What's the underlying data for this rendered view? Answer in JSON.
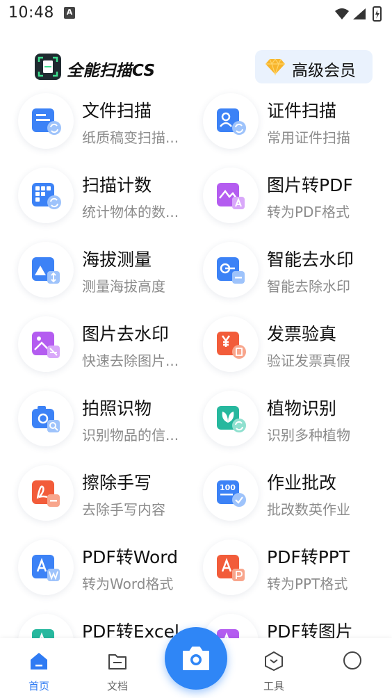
{
  "status_bar": {
    "time": "10:48",
    "notification_letter": "A"
  },
  "header": {
    "app_title": "全能扫描CS",
    "vip_label": "高级会员"
  },
  "colors": {
    "accent": "#2f86f6",
    "tab_active": "#2f7bf3",
    "vip_bg": "#eaf2fd"
  },
  "tools": [
    {
      "title": "文件扫描",
      "subtitle": "纸质稿变扫描...",
      "icon": "document-scan-icon"
    },
    {
      "title": "证件扫描",
      "subtitle": "常用证件扫描",
      "icon": "id-card-scan-icon"
    },
    {
      "title": "扫描计数",
      "subtitle": "统计物体的数...",
      "icon": "scan-count-icon"
    },
    {
      "title": "图片转PDF",
      "subtitle": "转为PDF格式",
      "icon": "image-to-pdf-icon"
    },
    {
      "title": "海拔测量",
      "subtitle": "测量海拔高度",
      "icon": "altitude-icon"
    },
    {
      "title": "智能去水印",
      "subtitle": "智能去除水印",
      "icon": "smart-watermark-remove-icon"
    },
    {
      "title": "图片去水印",
      "subtitle": "快速去除图片...",
      "icon": "image-watermark-remove-icon"
    },
    {
      "title": "发票验真",
      "subtitle": "验证发票真假",
      "icon": "invoice-verify-icon"
    },
    {
      "title": "拍照识物",
      "subtitle": "识别物品的信...",
      "icon": "photo-identify-icon"
    },
    {
      "title": "植物识别",
      "subtitle": "识别多种植物",
      "icon": "plant-identify-icon"
    },
    {
      "title": "擦除手写",
      "subtitle": "去除手写内容",
      "icon": "erase-handwriting-icon"
    },
    {
      "title": "作业批改",
      "subtitle": "批改数英作业",
      "icon": "homework-grading-icon"
    },
    {
      "title": "PDF转Word",
      "subtitle": "转为Word格式",
      "icon": "pdf-to-word-icon"
    },
    {
      "title": "PDF转PPT",
      "subtitle": "转为PPT格式",
      "icon": "pdf-to-ppt-icon"
    },
    {
      "title": "PDF转Excel",
      "subtitle": "",
      "icon": "pdf-to-excel-icon"
    },
    {
      "title": "PDF转图片",
      "subtitle": "",
      "icon": "pdf-to-image-icon"
    }
  ],
  "tabbar": {
    "home": "首页",
    "documents": "文档",
    "tools": "工具",
    "me": ""
  }
}
